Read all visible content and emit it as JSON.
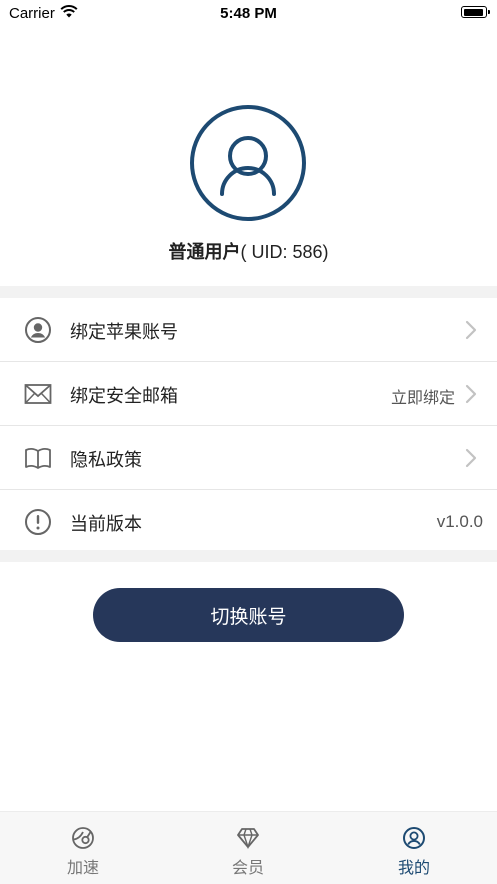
{
  "status_bar": {
    "carrier": "Carrier",
    "time": "5:48 PM"
  },
  "profile": {
    "name": "普通用户",
    "uid_text": "( UID: 586)"
  },
  "menu": [
    {
      "icon": "user-circle-icon",
      "label": "绑定苹果账号",
      "value": ""
    },
    {
      "icon": "envelope-icon",
      "label": "绑定安全邮箱",
      "value": "立即绑定"
    },
    {
      "icon": "book-icon",
      "label": "隐私政策",
      "value": ""
    },
    {
      "icon": "info-icon",
      "label": "当前版本",
      "value": "v1.0.0"
    }
  ],
  "switch_button": "切换账号",
  "tabs": [
    {
      "icon": "speed-globe-icon",
      "label": "加速",
      "active": false
    },
    {
      "icon": "diamond-icon",
      "label": "会员",
      "active": false
    },
    {
      "icon": "user-circle-icon",
      "label": "我的",
      "active": true
    }
  ],
  "colors": {
    "accent": "#1d4a72",
    "button": "#26375a",
    "band": "#f2f2f2"
  }
}
